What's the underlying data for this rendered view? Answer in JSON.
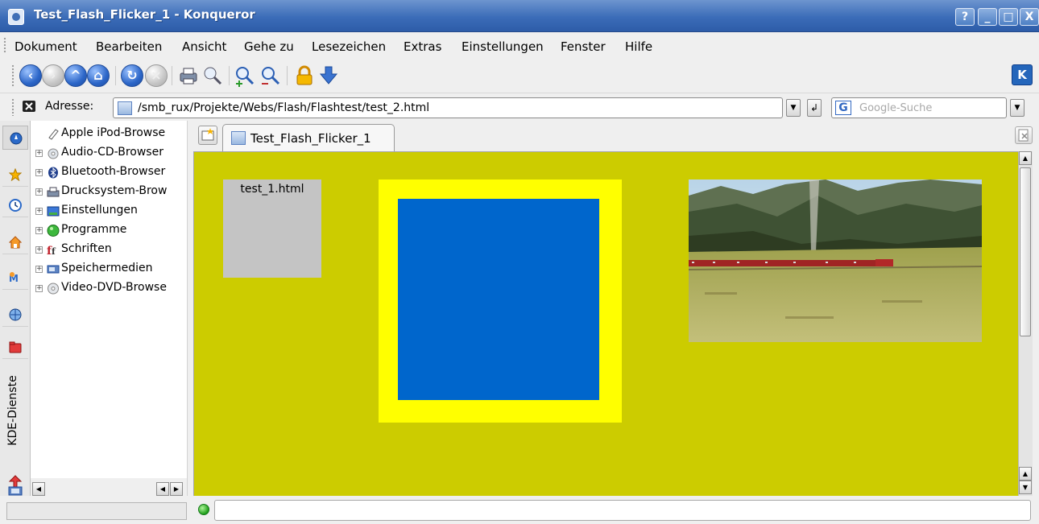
{
  "window": {
    "title": "Test_Flash_Flicker_1 - Konqueror",
    "buttons": {
      "help": "?",
      "minimize": "_",
      "maximize": "□",
      "close": "X"
    }
  },
  "menubar": {
    "items": [
      "Dokument",
      "Bearbeiten",
      "Ansicht",
      "Gehe zu",
      "Lesezeichen",
      "Extras",
      "Einstellungen",
      "Fenster",
      "Hilfe"
    ]
  },
  "toolbar": {
    "kde_logo": "K"
  },
  "location": {
    "label": "Adresse:",
    "url": "/smb_rux/Projekte/Webs/Flash/Flashtest/test_2.html",
    "search_placeholder": "Google-Suche",
    "search_icon_letter": "G"
  },
  "sidebar": {
    "vertical_tab_label": "KDE-Dienste",
    "tree_items": [
      "Apple iPod-Browse",
      "Audio-CD-Browser",
      "Bluetooth-Browser",
      "Drucksystem-Brow",
      "Einstellungen",
      "Programme",
      "Schriften",
      "Speichermedien",
      "Video-DVD-Browse"
    ]
  },
  "tabs": {
    "active_label": "Test_Flash_Flicker_1"
  },
  "page": {
    "background": "#cccc00",
    "flash_box_label": "test_1.html",
    "outer_square_color": "#ffff00",
    "inner_square_color": "#0066cc"
  },
  "status": {
    "message": ""
  }
}
